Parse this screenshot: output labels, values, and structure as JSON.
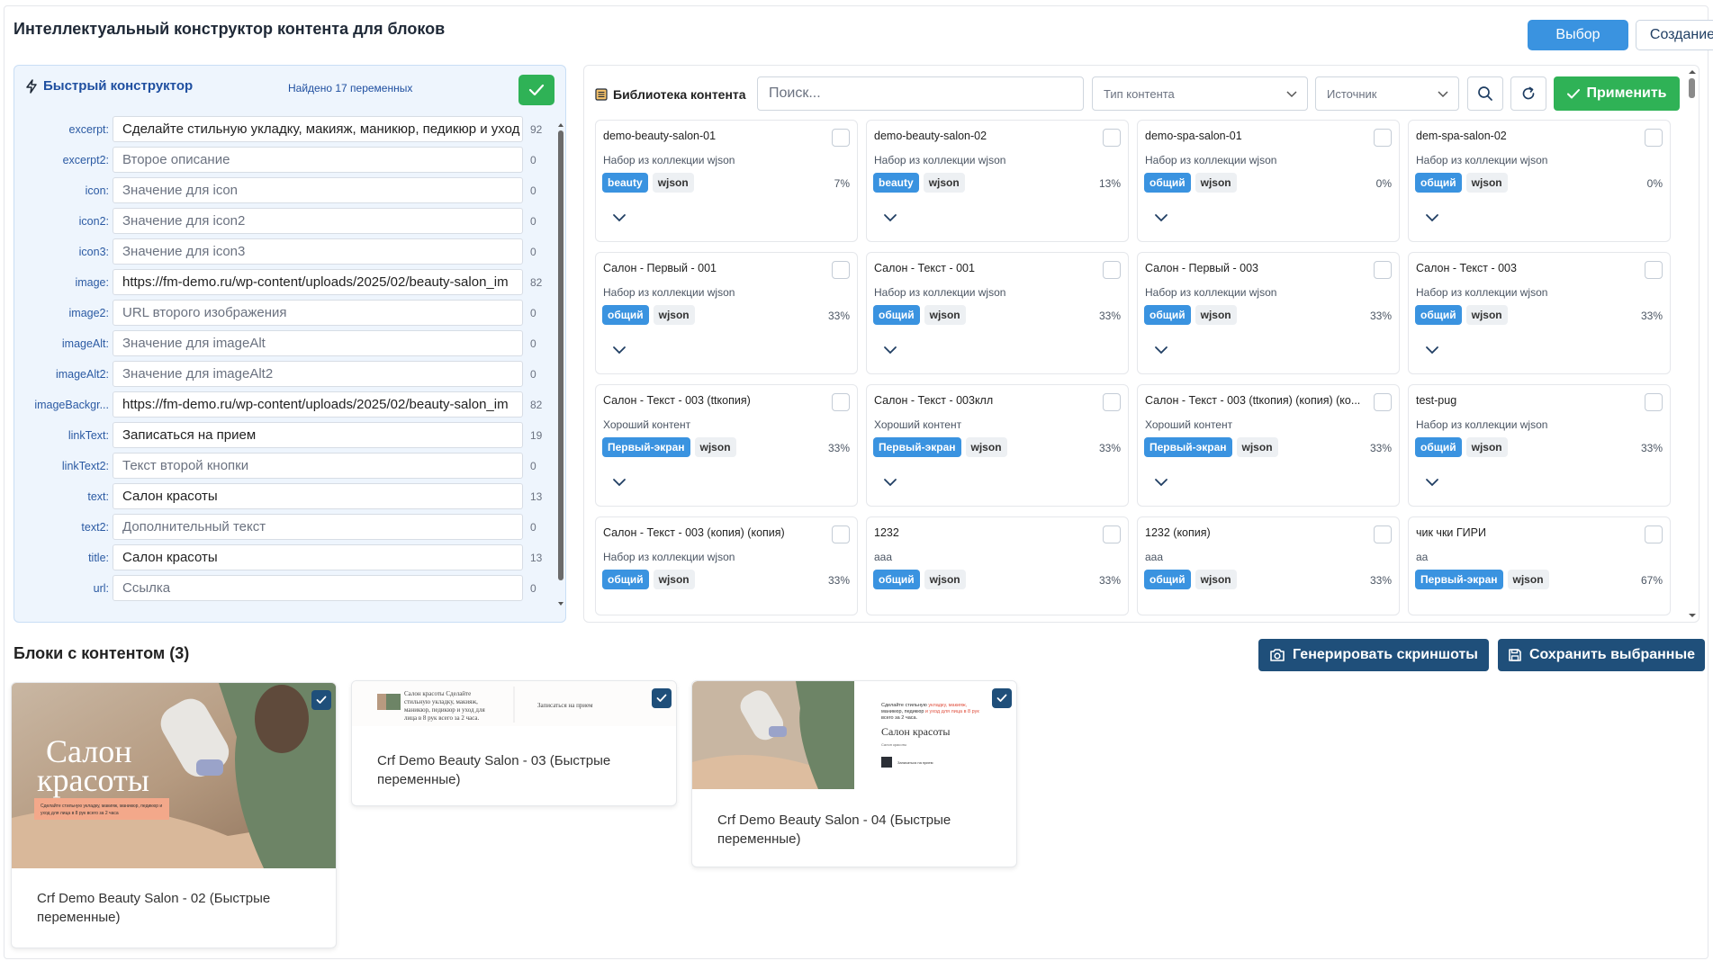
{
  "page_title": "Интеллектуальный конструктор контента для блоков",
  "top_buttons": {
    "select": "Выбор",
    "create": "Создание"
  },
  "quick_builder": {
    "title": "Быстрый конструктор",
    "found": "Найдено 17 переменных",
    "variables": [
      {
        "label": "excerpt:",
        "value": "Сделайте стильную укладку, макияж, маникюр, педикюр и уход",
        "placeholder": false,
        "count": "92"
      },
      {
        "label": "excerpt2:",
        "value": "Второе описание",
        "placeholder": true,
        "count": "0"
      },
      {
        "label": "icon:",
        "value": "Значение для icon",
        "placeholder": true,
        "count": "0"
      },
      {
        "label": "icon2:",
        "value": "Значение для icon2",
        "placeholder": true,
        "count": "0"
      },
      {
        "label": "icon3:",
        "value": "Значение для icon3",
        "placeholder": true,
        "count": "0"
      },
      {
        "label": "image:",
        "value": "https://fm-demo.ru/wp-content/uploads/2025/02/beauty-salon_im",
        "placeholder": false,
        "count": "82"
      },
      {
        "label": "image2:",
        "value": "URL второго изображения",
        "placeholder": true,
        "count": "0"
      },
      {
        "label": "imageAlt:",
        "value": "Значение для imageAlt",
        "placeholder": true,
        "count": "0"
      },
      {
        "label": "imageAlt2:",
        "value": "Значение для imageAlt2",
        "placeholder": true,
        "count": "0"
      },
      {
        "label": "imageBackgr...",
        "value": "https://fm-demo.ru/wp-content/uploads/2025/02/beauty-salon_im",
        "placeholder": false,
        "count": "82"
      },
      {
        "label": "linkText:",
        "value": "Записаться на прием",
        "placeholder": false,
        "count": "19"
      },
      {
        "label": "linkText2:",
        "value": "Текст второй кнопки",
        "placeholder": true,
        "count": "0"
      },
      {
        "label": "text:",
        "value": "Салон красоты",
        "placeholder": false,
        "count": "13"
      },
      {
        "label": "text2:",
        "value": "Дополнительный текст",
        "placeholder": true,
        "count": "0"
      },
      {
        "label": "title:",
        "value": "Салон красоты",
        "placeholder": false,
        "count": "13"
      },
      {
        "label": "url:",
        "value": "Ссылка",
        "placeholder": true,
        "count": "0"
      }
    ]
  },
  "library": {
    "title": "Библиотека контента",
    "search_placeholder": "Поиск...",
    "type_filter": "Тип контента",
    "source_filter": "Источник",
    "apply": "Применить",
    "cards": [
      {
        "title": "demo-beauty-salon-01",
        "desc": "Набор из коллекции wjson",
        "tag": "beauty",
        "source": "wjson",
        "pct": "7%"
      },
      {
        "title": "demo-beauty-salon-02",
        "desc": "Набор из коллекции wjson",
        "tag": "beauty",
        "source": "wjson",
        "pct": "13%"
      },
      {
        "title": "demo-spa-salon-01",
        "desc": "Набор из коллекции wjson",
        "tag": "общий",
        "source": "wjson",
        "pct": "0%"
      },
      {
        "title": "dem-spa-salon-02",
        "desc": "Набор из коллекции wjson",
        "tag": "общий",
        "source": "wjson",
        "pct": "0%"
      },
      {
        "title": "Салон - Первый - 001",
        "desc": "Набор из коллекции wjson",
        "tag": "общий",
        "source": "wjson",
        "pct": "33%"
      },
      {
        "title": "Салон - Текст - 001",
        "desc": "Набор из коллекции wjson",
        "tag": "общий",
        "source": "wjson",
        "pct": "33%"
      },
      {
        "title": "Салон - Первый - 003",
        "desc": "Набор из коллекции wjson",
        "tag": "общий",
        "source": "wjson",
        "pct": "33%"
      },
      {
        "title": "Салон - Текст - 003",
        "desc": "Набор из коллекции wjson",
        "tag": "общий",
        "source": "wjson",
        "pct": "33%"
      },
      {
        "title": "Салон - Текст - 003 (ttкопия)",
        "desc": "Хороший контент",
        "tag": "Первый-экран",
        "source": "wjson",
        "pct": "33%"
      },
      {
        "title": "Салон - Текст - 003клл",
        "desc": "Хороший контент",
        "tag": "Первый-экран",
        "source": "wjson",
        "pct": "33%"
      },
      {
        "title": "Салон - Текст - 003 (ttкопия) (копия) (ко...",
        "desc": "Хороший контент",
        "tag": "Первый-экран",
        "source": "wjson",
        "pct": "33%"
      },
      {
        "title": "test-pug",
        "desc": "Набор из коллекции wjson",
        "tag": "общий",
        "source": "wjson",
        "pct": "33%"
      },
      {
        "title": "Салон - Текст - 003 (копия) (копия)",
        "desc": "Набор из коллекции wjson",
        "tag": "общий",
        "source": "wjson",
        "pct": "33%"
      },
      {
        "title": "1232",
        "desc": "ааа",
        "tag": "общий",
        "source": "wjson",
        "pct": "33%"
      },
      {
        "title": "1232 (копия)",
        "desc": "ааа",
        "tag": "общий",
        "source": "wjson",
        "pct": "33%"
      },
      {
        "title": "чик чки ГИРИ",
        "desc": "аа",
        "tag": "Первый-экран",
        "source": "wjson",
        "pct": "67%"
      }
    ]
  },
  "blocks": {
    "title": "Блоки с контентом (3)",
    "generate": "Генерировать скриншоты",
    "save": "Сохранить выбранные",
    "items": [
      {
        "label": "Crf Demo Beauty Salon - 02 (Быстрые переменные)",
        "preview_title": "Салон красоты",
        "preview_text": "Сделайте стильную укладку, макияж, маникюр, педикюр и уход для лица в 8 рук всего за 2 часа"
      },
      {
        "label": "Crf Demo Beauty Salon - 03 (Быстрые переменные)",
        "preview_title": "Салон красоты Сделайте стильную укладку, макияж, маникюр, педикюр и уход для лица в 8 рук всего за 2 часа.",
        "preview_text": "Записаться на прием"
      },
      {
        "label": "Crf Demo Beauty Salon - 04 (Быстрые переменные)",
        "preview_title": "Салон красоты",
        "preview_text": "Сделайте стильную укладку, макияж, маникюр, педикюр и уход для лица в 8 рук всего за 2 часа."
      }
    ]
  },
  "colors": {
    "accent": "#3a93e0",
    "success": "#2fb256",
    "dark_button": "#1f4f7a"
  }
}
